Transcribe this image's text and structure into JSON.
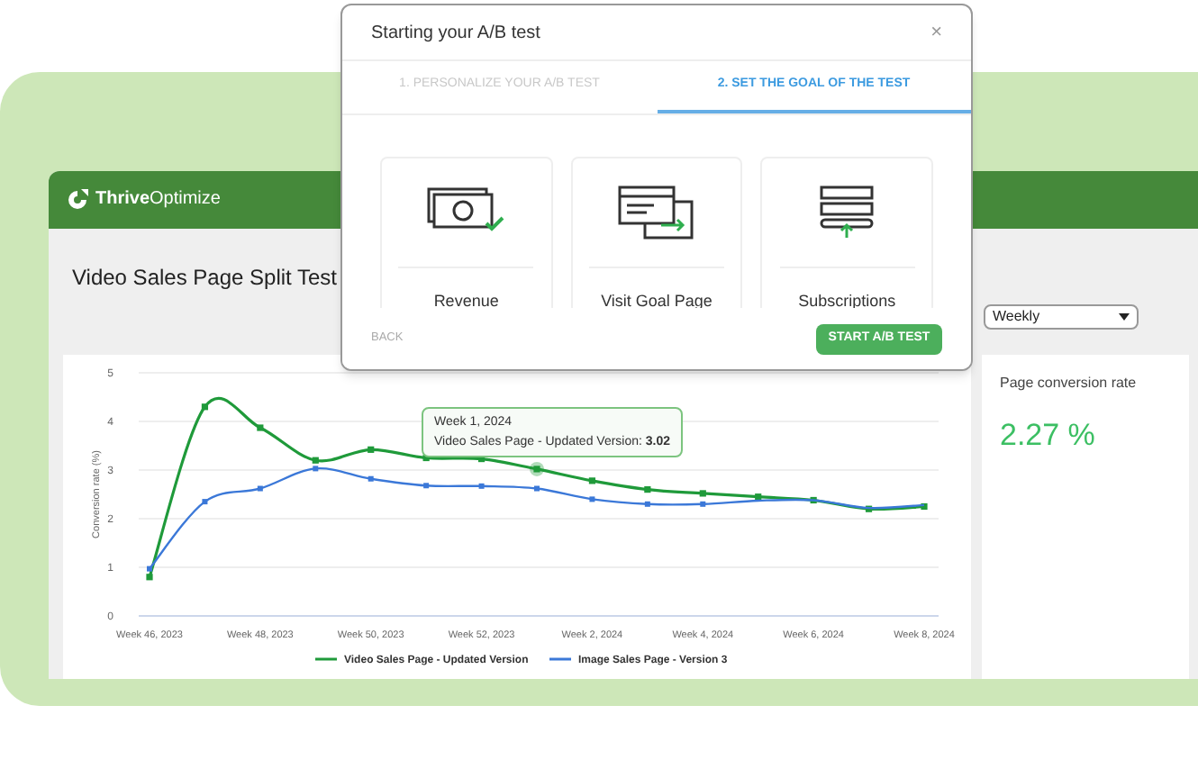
{
  "dashboard": {
    "brand_bold": "Thrive",
    "brand_light": "Optimize",
    "title": "Video Sales Page Split Test",
    "period_select": {
      "value": "Weekly"
    },
    "chart": {
      "chart_data": {
        "type": "line",
        "ylabel": "Conversion rate (%)",
        "categories": [
          "Week 46, 2023",
          null,
          "Week 48, 2023",
          null,
          "Week 50, 2023",
          null,
          "Week 52, 2023",
          null,
          "Week 2, 2024",
          null,
          "Week 4, 2024",
          null,
          "Week 6, 2024",
          null,
          "Week 8, 2024"
        ],
        "grid": true,
        "legend": "bottom",
        "ylim": [
          0,
          5
        ],
        "yticks": [
          0,
          1,
          2,
          3,
          4,
          5
        ],
        "series": [
          {
            "name": "Video Sales Page - Updated  Version",
            "color": "#1f9a3a",
            "marker": "square",
            "values": [
              0.8,
              4.3,
              3.87,
              3.2,
              3.42,
              3.25,
              3.23,
              3.02,
              2.78,
              2.6,
              2.52,
              2.45,
              2.38,
              2.2,
              2.25
            ]
          },
          {
            "name": "Image Sales Page - Version 3",
            "color": "#3b78d8",
            "marker": "square",
            "values": [
              0.97,
              2.35,
              2.62,
              3.03,
              2.82,
              2.68,
              2.67,
              2.62,
              2.4,
              2.3,
              2.3,
              2.37,
              2.38,
              2.22,
              2.28
            ]
          }
        ]
      },
      "tooltip": {
        "title": "Week 1, 2024",
        "label": "Video Sales Page - Updated  Version: ",
        "value": "3.02"
      }
    },
    "metric": {
      "label": "Page conversion rate",
      "value": "2.27 %"
    }
  },
  "modal": {
    "title": "Starting your A/B test",
    "close": "×",
    "steps": [
      {
        "label": "1. PERSONALIZE YOUR A/B TEST",
        "selected": false
      },
      {
        "label": "2. SET THE GOAL OF THE TEST",
        "selected": true
      }
    ],
    "goals": [
      {
        "kind": "revenue",
        "label": "Revenue"
      },
      {
        "kind": "visit",
        "label": "Visit Goal Page"
      },
      {
        "kind": "subscriptions",
        "label": "Subscriptions"
      }
    ],
    "back": "BACK",
    "start": "START A/B TEST"
  }
}
